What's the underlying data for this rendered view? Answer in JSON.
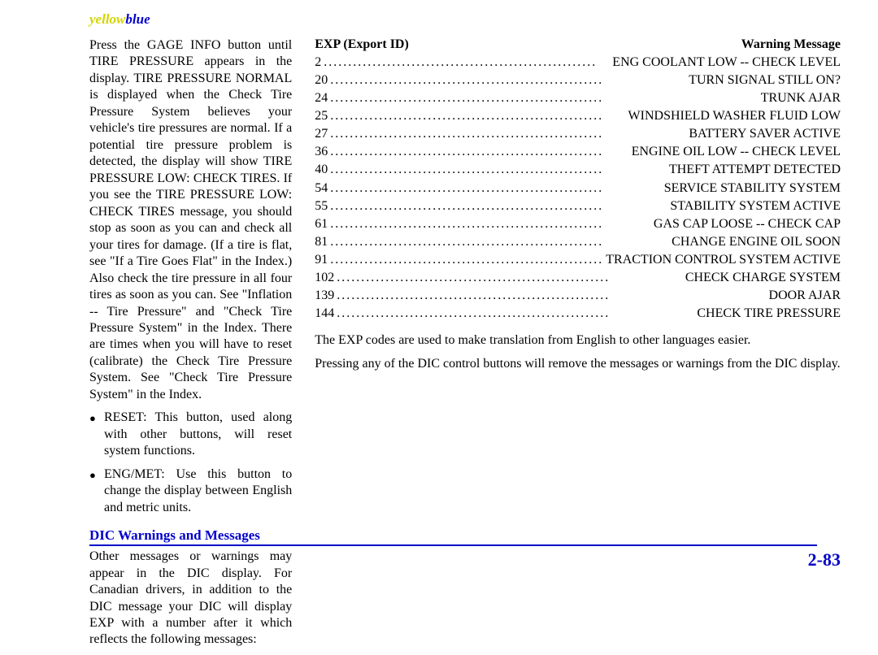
{
  "header": {
    "label_yellow": "yellow",
    "label_blue": "blue"
  },
  "left": {
    "tire_pressure_para": "Press the GAGE INFO button until TIRE PRESSURE appears in the display. TIRE PRESSURE NORMAL is displayed when the Check Tire Pressure System believes your vehicle's tire pressures are normal. If a potential tire pressure problem is detected, the display will show TIRE PRESSURE LOW: CHECK TIRES. If you see the TIRE PRESSURE LOW: CHECK TIRES message, you should stop as soon as you can and check all your tires for damage. (If a tire is flat, see \"If a Tire Goes Flat\" in the Index.) Also check the tire pressure in all four tires as soon as you can. See \"Inflation -- Tire Pressure\" and \"Check Tire Pressure System\" in the Index. There are times when you will have to reset (calibrate) the Check Tire Pressure System. See \"Check Tire Pressure System\" in the Index.",
    "bullets": [
      "RESET: This button, used along with other buttons, will reset system functions.",
      "ENG/MET: Use this button to change the display between English and metric units."
    ],
    "section_heading": "DIC Warnings and Messages",
    "dic_para": "Other messages or warnings may appear in the DIC display. For Canadian drivers, in addition to the DIC message your DIC will display EXP with a number after it which reflects the following messages:"
  },
  "right": {
    "table_left_header": "EXP (Export ID)",
    "table_right_header": "Warning Message",
    "rows": [
      {
        "id": "2",
        "msg": "ENG COOLANT LOW -- CHECK LEVEL"
      },
      {
        "id": "20",
        "msg": "TURN SIGNAL STILL ON?"
      },
      {
        "id": "24",
        "msg": "TRUNK AJAR"
      },
      {
        "id": "25",
        "msg": "WINDSHIELD WASHER FLUID LOW"
      },
      {
        "id": "27",
        "msg": "BATTERY SAVER ACTIVE"
      },
      {
        "id": "36",
        "msg": "ENGINE OIL LOW -- CHECK LEVEL"
      },
      {
        "id": "40",
        "msg": "THEFT ATTEMPT DETECTED"
      },
      {
        "id": "54",
        "msg": "SERVICE STABILITY SYSTEM"
      },
      {
        "id": "55",
        "msg": "STABILITY SYSTEM ACTIVE"
      },
      {
        "id": "61",
        "msg": "GAS CAP LOOSE -- CHECK CAP"
      },
      {
        "id": "81",
        "msg": "CHANGE ENGINE OIL SOON"
      },
      {
        "id": "91",
        "msg": "TRACTION CONTROL SYSTEM ACTIVE"
      },
      {
        "id": "102",
        "msg": "CHECK CHARGE SYSTEM"
      },
      {
        "id": "139",
        "msg": "DOOR AJAR"
      },
      {
        "id": "144",
        "msg": "CHECK TIRE PRESSURE"
      }
    ],
    "exp_note": "The EXP codes are used to make translation from English to other languages easier.",
    "dic_buttons_note": "Pressing any of the DIC control buttons will remove the messages or warnings from the DIC display."
  },
  "page_number": "2-83"
}
